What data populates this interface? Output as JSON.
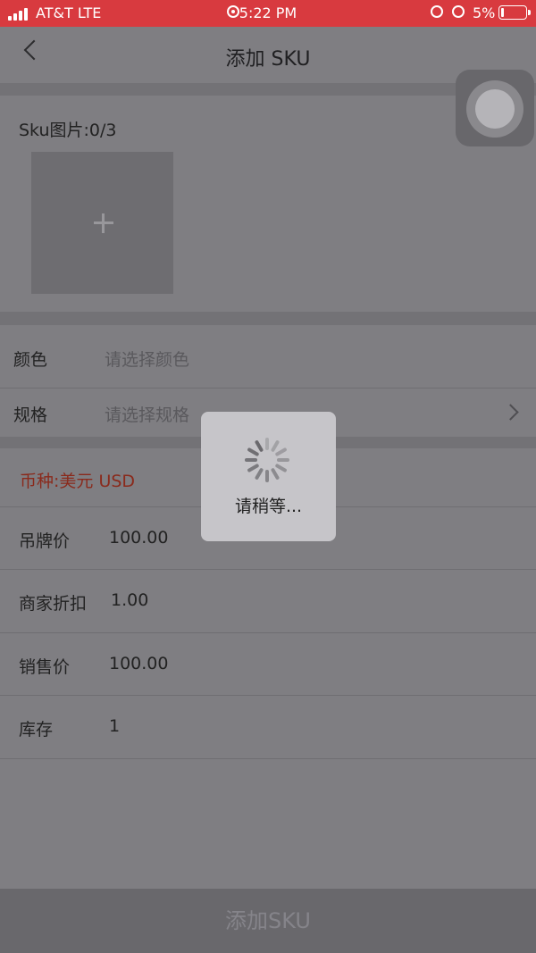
{
  "status_bar": {
    "carrier": "AT&T LTE",
    "time": "5:22 PM",
    "battery": "5%",
    "battery_level": 0.05,
    "background": "#d83a3f"
  },
  "header": {
    "title": "添加 SKU"
  },
  "image_section": {
    "label": "Sku图片:0/3",
    "add_glyph": "+"
  },
  "attributes": [
    {
      "label": "颜色",
      "placeholder": "请选择颜色"
    },
    {
      "label": "规格",
      "placeholder": "请选择规格"
    }
  ],
  "currency": {
    "text": "币种:美元 USD",
    "color": "#8a2a1c"
  },
  "price_rows": [
    {
      "label": "吊牌价",
      "value": "100.00"
    },
    {
      "label": "商家折扣",
      "value": "1.00"
    },
    {
      "label": "销售价",
      "value": "100.00"
    },
    {
      "label": "库存",
      "value": "1"
    }
  ],
  "submit_button": {
    "label": "添加SKU"
  },
  "loading": {
    "text": "请稍等..."
  },
  "icons": [
    "signal-icon",
    "screen-record-icon",
    "alarm-icon",
    "orientation-lock-icon",
    "battery-icon",
    "back-icon",
    "plus-icon",
    "assistive-touch-icon",
    "chevron-right-icon",
    "spinner-icon"
  ]
}
